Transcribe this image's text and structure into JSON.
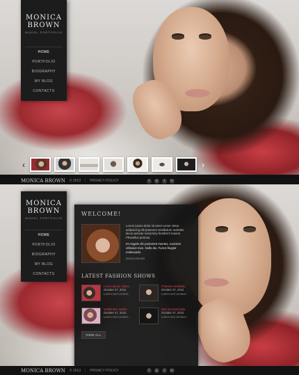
{
  "brand": {
    "name": "MONICA BROWN",
    "subtitle": "MODEL PORTFOLIO"
  },
  "nav": [
    {
      "label": "HOME"
    },
    {
      "label": "PORTFOLIO"
    },
    {
      "label": "BIOGRAPHY"
    },
    {
      "label": "MY BLOG"
    },
    {
      "label": "CONTACTS"
    }
  ],
  "thumbnails": {
    "prev": "‹",
    "next": "›",
    "count": 7
  },
  "footer": {
    "brand": "MONICA BROWN",
    "year": "© 2013",
    "separator": "|",
    "policy": "PRIVACY POLICY",
    "social": [
      "f",
      "◎",
      "t",
      "in"
    ]
  },
  "welcome": {
    "title": "WELCOME!",
    "paragraph_1": "Lorem ipsum dolor sit amet conse ctetur adipisicing elit praesent vestibulum molestie lacus aenean nonummy hendrerit mauris. Phasellus portosa.",
    "paragraph_2": "Et magnis dis parturient montes, nascetur ridiculus mus. Nulla dui. Fusce feugiat malesuada.",
    "author": "Monica Brown"
  },
  "shows": {
    "title": "LATEST FASHION SHOWS",
    "items": [
      {
        "name": "Lorem ipsum dolam.",
        "date": "October 27, 2012",
        "more": "Lorem sed consect..."
      },
      {
        "name": "Praesent vestibulu.",
        "date": "October 27, 2012",
        "more": "Lorem sed consect..."
      },
      {
        "name": "Vestibulum iaculis.",
        "date": "October 27, 2012",
        "more": "Lorem sed consect..."
      },
      {
        "name": "Sed ut perspiciatis.",
        "date": "October 27, 2012",
        "more": "Lorem sed consect..."
      }
    ],
    "view_all": "VIEW ALL"
  },
  "colors": {
    "accent": "#e0444a",
    "sidebar": "#1c1c1c",
    "footer": "#121212"
  }
}
